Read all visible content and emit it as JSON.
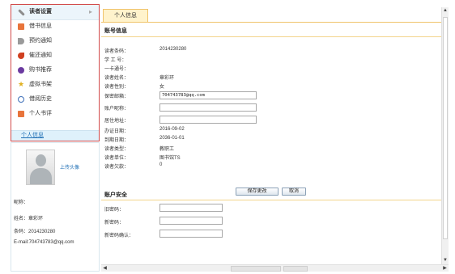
{
  "sidebar": {
    "items": [
      {
        "label": "读者设置",
        "icon": "wrench-icon",
        "color": "#7a7a7a"
      },
      {
        "label": "借书信息",
        "icon": "book-icon",
        "color": "#e8743b"
      },
      {
        "label": "预约通知",
        "icon": "speaker-icon",
        "color": "#8a8a8a"
      },
      {
        "label": "催还通知",
        "icon": "alarm-icon",
        "color": "#d04020"
      },
      {
        "label": "购书推荐",
        "icon": "cart-icon",
        "color": "#6b3aa0"
      },
      {
        "label": "虚拟书架",
        "icon": "star-icon",
        "color": "#e0b020"
      },
      {
        "label": "借阅历史",
        "icon": "clock-icon",
        "color": "#3d6fb8"
      },
      {
        "label": "个人书评",
        "icon": "note-icon",
        "color": "#e8743b"
      }
    ],
    "bottom_label": "个人信息"
  },
  "profile": {
    "upload_label": "上传头像",
    "nickname": "昵称：",
    "name": "姓名：章彩环",
    "barcode": "条码：2014230280",
    "email": "E-mail:704743783@qq.com"
  },
  "main": {
    "tab_label": "个人信息",
    "account_title": "账号信息",
    "fields": {
      "barcode_label": "读者条码：",
      "barcode_value": "2014230280",
      "student_id_label": "学 工 号：",
      "card_label": "一卡通号：",
      "name_label": "读者姓名：",
      "name_value": "章彩环",
      "gender_label": "读者性别：",
      "gender_value": "女",
      "email_label": "保密邮箱：",
      "email_value": "704743783@qq.com",
      "nickname_label": "账户昵称：",
      "nickname_value": "",
      "address_label": "居住地址：",
      "address_value": "",
      "issue_label": "办证日期：",
      "issue_value": "2016-09-02",
      "expire_label": "到期日期：",
      "expire_value": "2036-01-01",
      "type_label": "读者类型：",
      "type_value": "教职工",
      "unit_label": "读者单位：",
      "unit_value": "图书馆TS",
      "debt_label": "读者欠款：",
      "debt_value": "0"
    },
    "save_label": "保存更改",
    "cancel_label": "取消",
    "security_title": "账户安全",
    "security": {
      "old_label": "旧密码：",
      "new_label": "新密码：",
      "confirm_label": "新密码确认："
    }
  }
}
